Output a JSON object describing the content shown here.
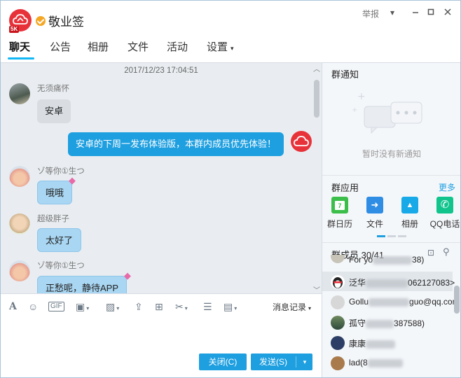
{
  "header": {
    "title": "敬业签",
    "avatar_tag": "5K",
    "report": "举报",
    "tabs": [
      "聊天",
      "公告",
      "相册",
      "文件",
      "活动",
      "设置"
    ],
    "active_tab": "聊天"
  },
  "chat": {
    "timestamp": "2017/12/23 17:04:51",
    "messages": [
      {
        "sender": "无须痛怀",
        "text": "安卓"
      },
      {
        "sender": "",
        "text": "安卓的下周一发布体验版，本群内成员优先体验！"
      },
      {
        "sender": "ゾ等你①生つ",
        "text": "哦哦"
      },
      {
        "sender": "超级胖子",
        "text": "太好了"
      },
      {
        "sender": "ゾ等你①生つ",
        "text": "正愁呢，静待APP"
      }
    ]
  },
  "toolbar": {
    "history_label": "消息记录",
    "icons": [
      "font-icon",
      "emoji-icon",
      "gif-icon",
      "gift-icon",
      "image-icon",
      "upload-icon",
      "present-icon",
      "scissors-icon",
      "red-packet-icon",
      "screen-icon"
    ]
  },
  "buttons": {
    "close": "关闭(C)",
    "send": "发送(S)"
  },
  "right": {
    "notice_title": "群通知",
    "notice_empty": "暂时没有新通知",
    "apps_title": "群应用",
    "apps_more": "更多",
    "apps": [
      {
        "label": "群日历",
        "color": "#3bbf4a",
        "icon": "calendar-icon",
        "glyph": "7"
      },
      {
        "label": "文件",
        "color": "#2f8de4",
        "icon": "folder-icon",
        "glyph": "➜"
      },
      {
        "label": "相册",
        "color": "#17a9e8",
        "icon": "photo-icon",
        "glyph": "▲"
      },
      {
        "label": "QQ电话",
        "color": "#10c48c",
        "icon": "phone-icon",
        "glyph": "✆"
      }
    ],
    "members_title": "群成员 30/41",
    "members": [
      {
        "name": "For yo",
        "tail": "38)"
      },
      {
        "name": "泛华",
        "tail": "062127083>"
      },
      {
        "name": "Gollu",
        "tail": "guo@qq.com"
      },
      {
        "name": "孤守",
        "tail": "387588)"
      },
      {
        "name": "康康",
        "tail": ""
      },
      {
        "name": "lad(8",
        "tail": ""
      }
    ]
  },
  "colors": {
    "accent": "#1e9fe0",
    "brand_red": "#e8323a",
    "chat_bg": "#e9edf1"
  }
}
